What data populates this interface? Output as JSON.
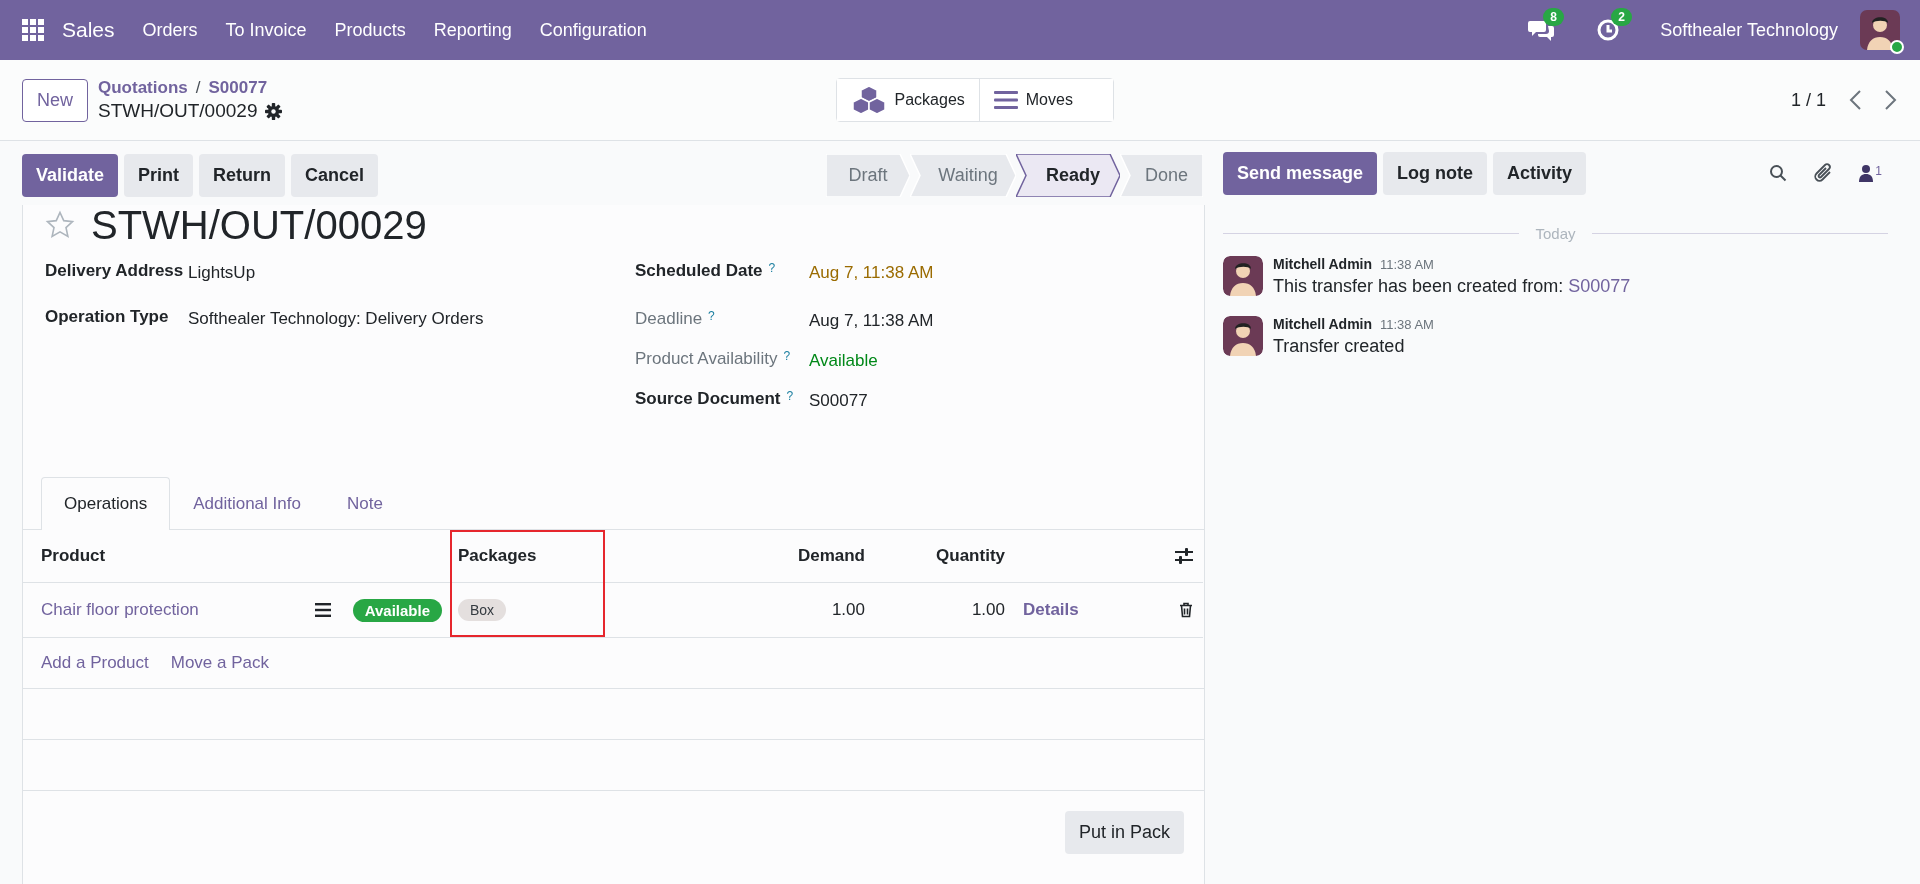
{
  "navbar": {
    "app": "Sales",
    "menu": [
      "Orders",
      "To Invoice",
      "Products",
      "Reporting",
      "Configuration"
    ],
    "messages_count": "8",
    "activities_count": "2",
    "company": "Softhealer Technology",
    "user_online": true
  },
  "breadcrumb": {
    "new_button": "New",
    "path": [
      "Quotations",
      "S00077"
    ],
    "separator": "/",
    "record": "STWH/OUT/00029"
  },
  "smart_buttons": [
    {
      "kind": "packages",
      "label": "Packages"
    },
    {
      "kind": "moves",
      "label": "Moves"
    }
  ],
  "pager": "1 / 1",
  "actions": [
    {
      "label": "Validate",
      "kind": "primary"
    },
    {
      "label": "Print",
      "kind": "secondary"
    },
    {
      "label": "Return",
      "kind": "secondary"
    },
    {
      "label": "Cancel",
      "kind": "secondary"
    }
  ],
  "status_bar": [
    {
      "label": "Draft",
      "selected": false
    },
    {
      "label": "Waiting",
      "selected": false
    },
    {
      "label": "Ready",
      "selected": true
    },
    {
      "label": "Done",
      "selected": false
    }
  ],
  "chatter_buttons": [
    {
      "label": "Send message",
      "kind": "primary"
    },
    {
      "label": "Log note",
      "kind": "secondary"
    },
    {
      "label": "Activity",
      "kind": "secondary"
    }
  ],
  "followers_count": "1",
  "form": {
    "title": "STWH/OUT/00029",
    "starred": false,
    "left_fields": [
      {
        "label": "Delivery Address",
        "value": "LightsUp",
        "emphasis": true
      },
      {
        "label": "Operation Type",
        "value": "Softhealer Technology: Delivery Orders",
        "emphasis": true
      }
    ],
    "right_fields": [
      {
        "label": "Scheduled Date",
        "help_mark": "?",
        "value": "Aug 7, 11:38 AM",
        "emphasis": true,
        "kind": "warning"
      },
      {
        "label": "Deadline",
        "help_mark": "?",
        "value": "Aug 7, 11:38 AM",
        "emphasis": false
      },
      {
        "label": "Product Availability",
        "help_mark": "?",
        "value": "Available",
        "emphasis": false,
        "kind": "success"
      },
      {
        "label": "Source Document",
        "help_mark": "?",
        "value": "S00077",
        "emphasis": true
      }
    ]
  },
  "tabs": [
    {
      "label": "Operations",
      "selected": true
    },
    {
      "label": "Additional Info",
      "selected": false
    },
    {
      "label": "Note",
      "selected": false
    }
  ],
  "table": {
    "columns": [
      {
        "label": "Product",
        "numeric": false,
        "highlighted": false
      },
      {
        "label": "Packages",
        "numeric": false,
        "highlighted": true
      },
      {
        "label": "Demand",
        "numeric": true,
        "highlighted": false
      },
      {
        "label": "Quantity",
        "numeric": true,
        "highlighted": false
      }
    ],
    "rows": [
      {
        "product": "Chair floor protection",
        "availability": "Available",
        "package": "Box",
        "demand": "1.00",
        "quantity": "1.00",
        "details": "Details"
      }
    ],
    "add_links": [
      "Add a Product",
      "Move a Pack"
    ],
    "put_in_pack": "Put in Pack"
  },
  "chatter": {
    "date_separator": "Today",
    "messages": [
      {
        "author": "Mitchell Admin",
        "time": "11:38 AM",
        "body": "This transfer has been created from: ",
        "link": "S00077"
      },
      {
        "author": "Mitchell Admin",
        "time": "11:38 AM",
        "body": "Transfer created"
      }
    ]
  }
}
